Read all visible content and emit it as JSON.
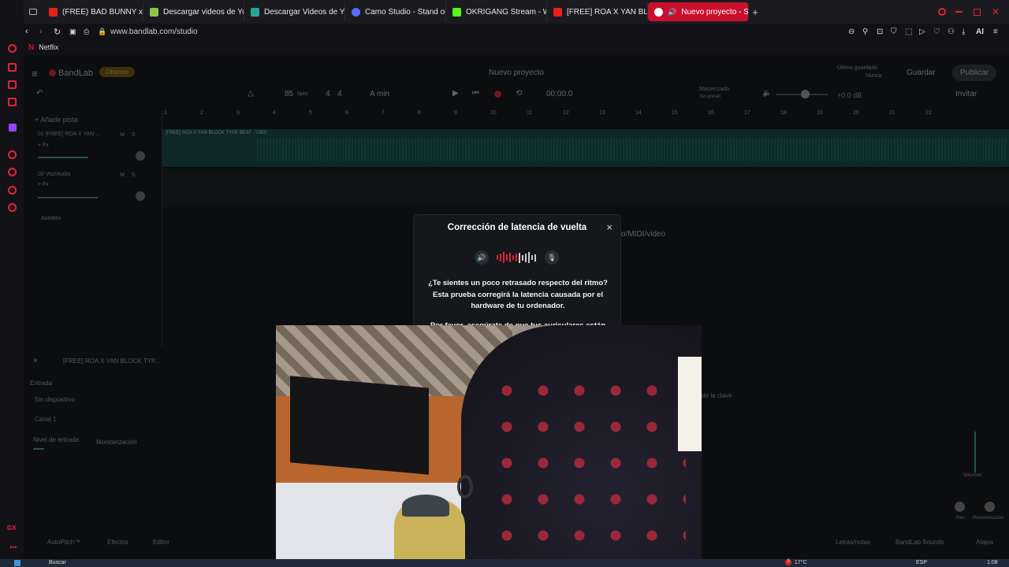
{
  "browser": {
    "tabs": [
      {
        "label": "(FREE) BAD BUNNY x TAI",
        "color": "#e62117"
      },
      {
        "label": "Descargar videos de YouT",
        "color": "#8bc34a"
      },
      {
        "label": "Descargar Videos de YouT",
        "color": "#26a69a"
      },
      {
        "label": "Camo Studio - Stand out",
        "color": "#5b6cff"
      },
      {
        "label": "OKRIGANG Stream - Watc",
        "color": "#53fc18"
      },
      {
        "label": "[FREE] ROA X YAN BLOCK",
        "color": "#e62117"
      },
      {
        "label": "Nuevo proyecto - Stud",
        "color": "#ffffff"
      }
    ],
    "new_tab": "+",
    "url": "www.bandlab.com/studio",
    "toolbar_ai": "AI",
    "bookmark": "Netflix"
  },
  "studio": {
    "brand": "BandLab",
    "get_badge": "Obtener",
    "project_title": "Nuevo proyecto",
    "last_saved_label": "Último guardado",
    "last_saved_value": "Nunca",
    "save": "Guardar",
    "publish": "Publicar",
    "bpm": "85",
    "bpm_unit": "bpm",
    "time_sig_a": "4",
    "time_sig_b": "4",
    "key": "A min",
    "time": "00:00.0",
    "mastering_label": "Masterizado",
    "mastering_sub": "Sin preset",
    "volume_db": "+0.0 dB",
    "invite": "Invitar",
    "add_track": "Añadir pista",
    "ruler": [
      "1",
      "2",
      "3",
      "4",
      "5",
      "6",
      "7",
      "8",
      "9",
      "10",
      "11",
      "12",
      "13",
      "14",
      "15",
      "16",
      "17",
      "18",
      "19",
      "20",
      "21",
      "22"
    ],
    "tracks": [
      {
        "name": "01  [FREE] ROA X YAN ...",
        "fx": "+ Fx",
        "m": "M",
        "s": "S"
      },
      {
        "name": "02  Voz/Audio",
        "fx": "+ Fx",
        "m": "M",
        "s": "S"
      }
    ],
    "region_label": "[FREE] ROA X YAN BLOCK TYPE BEAT - 'OBS'",
    "automix": "AutoMix",
    "drop_hint": "o/MIDI/video",
    "panel_track": "[FREE] ROA X YAN BLOCK TYP...",
    "input_label": "Entrada",
    "input_device": "Sin dispositivo",
    "channel": "Canal 1",
    "input_level": "Nivel de entrada",
    "monitoring": "Monitorización",
    "key_hint": "ate la clave",
    "volume_label": "Volumen",
    "pan_label": "Pan",
    "reverb_label": "Reverberación",
    "bottom_left": [
      "AutoPitch™",
      "Efectos",
      "Editor"
    ],
    "bottom_right": [
      "Letras/notas",
      "BandLab Sounds",
      "Atajos"
    ]
  },
  "modal": {
    "title": "Corrección de latencia de vuelta",
    "close": "×",
    "line1": "¿Te sientes un poco retrasado respecto del ritmo?",
    "line2": "Esta prueba corregirá la latencia causada por el",
    "line3": "hardware de tu ordenador.",
    "line4": "Por favor, asegúrate de que tus auriculares están"
  },
  "taskbar": {
    "search": "Buscar",
    "weather": "17°C",
    "notif": "3",
    "lang": "ESP",
    "clock": "1:08"
  },
  "colors": {
    "accent": "#c8102e",
    "waveform": "#0f4a44"
  }
}
